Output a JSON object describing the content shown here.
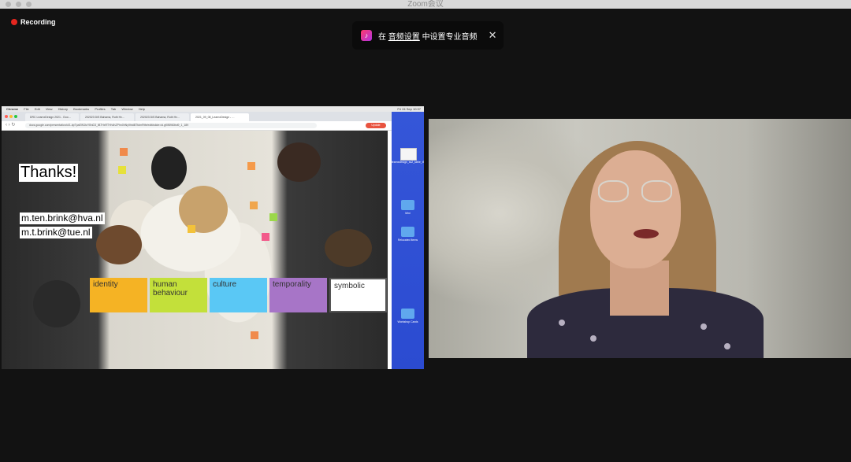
{
  "window": {
    "title": "Zoom会议"
  },
  "recording": {
    "label": "Recording"
  },
  "banner": {
    "prefix": "在",
    "link": "音频设置",
    "suffix": "中设置专业音频",
    "close": "✕"
  },
  "share": {
    "menubar": [
      "Chrome",
      "File",
      "Edit",
      "View",
      "History",
      "Bookmarks",
      "Profiles",
      "Tab",
      "Window",
      "Help"
    ],
    "clock": "Fri 24 Sep 10:37",
    "tabs": [
      "DRC LearnxDesign 2021 - Goo…",
      "202023 DiS Bahama, Ruth Hv…",
      "202023 DiS Bahama, Ruth Hv…",
      "2021_09_08_LearnxDesign - …"
    ],
    "url": "docs.google.com/presentation/d/1-dpTpaEW1tcYBnD3_tB7HxRTHh4hZPhn0hNy9htdBTtdmRtfe/edit#slide=id.gf0f8960bd9_1_189",
    "update": "Update",
    "slide": {
      "title": "Thanks!",
      "emails": [
        "m.ten.brink@hva.nl",
        "m.t.brink@tue.nl"
      ],
      "categories": [
        {
          "label": "identity",
          "color": "#f5b324"
        },
        {
          "label": "human behaviour",
          "color": "#c3e03a"
        },
        {
          "label": "culture",
          "color": "#5ac8f5"
        },
        {
          "label": "temporality",
          "color": "#a775c7"
        },
        {
          "label": "symbolic",
          "color": "#ffffff"
        }
      ]
    },
    "desktop": [
      {
        "label": "learnxdesign_ss2_table_t5.png"
      },
      {
        "label": "Mini"
      },
      {
        "label": "Relocated Items"
      },
      {
        "label": "Workshop Cards"
      }
    ]
  }
}
